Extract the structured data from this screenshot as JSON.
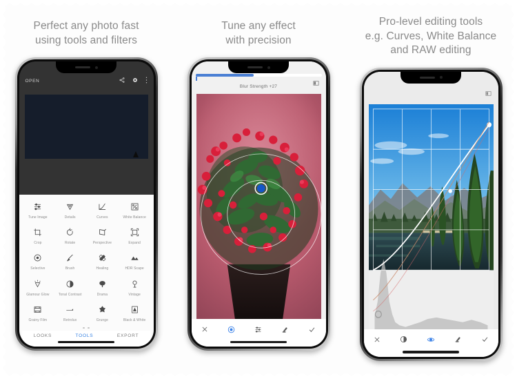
{
  "panels": [
    {
      "caption_lines": [
        "Perfect any photo fast",
        "using tools and filters"
      ],
      "app": {
        "top_label": "OPEN",
        "top_icons": [
          "share-icon",
          "settings-icon",
          "more-vert-icon"
        ],
        "tools": [
          {
            "label": "Tune Image",
            "icon": "sliders-icon"
          },
          {
            "label": "Details",
            "icon": "triangle-detail-icon"
          },
          {
            "label": "Curves",
            "icon": "curves-icon"
          },
          {
            "label": "White Balance",
            "icon": "white-balance-icon"
          },
          {
            "label": "Crop",
            "icon": "crop-icon"
          },
          {
            "label": "Rotate",
            "icon": "rotate-icon"
          },
          {
            "label": "Perspective",
            "icon": "perspective-icon"
          },
          {
            "label": "Expand",
            "icon": "expand-icon"
          },
          {
            "label": "Selective",
            "icon": "selective-icon"
          },
          {
            "label": "Brush",
            "icon": "brush-icon"
          },
          {
            "label": "Healing",
            "icon": "healing-icon"
          },
          {
            "label": "HDR Scape",
            "icon": "hdr-scape-icon"
          },
          {
            "label": "Glamour Glow",
            "icon": "glamour-glow-icon"
          },
          {
            "label": "Tonal Contrast",
            "icon": "tonal-contrast-icon"
          },
          {
            "label": "Drama",
            "icon": "drama-icon"
          },
          {
            "label": "Vintage",
            "icon": "vintage-icon"
          },
          {
            "label": "Grainy Film",
            "icon": "grainy-film-icon"
          },
          {
            "label": "Retrolux",
            "icon": "retrolux-icon"
          },
          {
            "label": "Grunge",
            "icon": "grunge-icon"
          },
          {
            "label": "Black & White",
            "icon": "black-white-icon"
          }
        ],
        "tabs": [
          {
            "label": "LOOKS",
            "active": false
          },
          {
            "label": "TOOLS",
            "active": true
          },
          {
            "label": "EXPORT",
            "active": false
          }
        ],
        "accent_color": "#2f7de1"
      }
    },
    {
      "caption_lines": [
        "Tune any effect",
        "with precision"
      ],
      "app": {
        "adjust_title": "Blur Strength +27",
        "slider_fill_percent": 46,
        "slider_color": "#4a7fd4",
        "compare_icon": "compare-icon",
        "toolbar": [
          {
            "icon": "close-icon",
            "active": false
          },
          {
            "icon": "target-icon",
            "active": true
          },
          {
            "icon": "sliders-icon",
            "active": false
          },
          {
            "icon": "stamp-icon",
            "active": false
          },
          {
            "icon": "check-icon",
            "active": false
          }
        ]
      }
    },
    {
      "caption_lines": [
        "Pro-level editing tools",
        "e.g. Curves, White Balance",
        "and RAW editing"
      ],
      "app": {
        "compare_icon": "compare-icon",
        "toolbar": [
          {
            "icon": "close-icon",
            "active": false
          },
          {
            "icon": "preset-circle-icon",
            "active": false
          },
          {
            "icon": "eye-icon",
            "active": true
          },
          {
            "icon": "stamp-icon",
            "active": false
          },
          {
            "icon": "check-icon",
            "active": false
          }
        ]
      }
    }
  ]
}
